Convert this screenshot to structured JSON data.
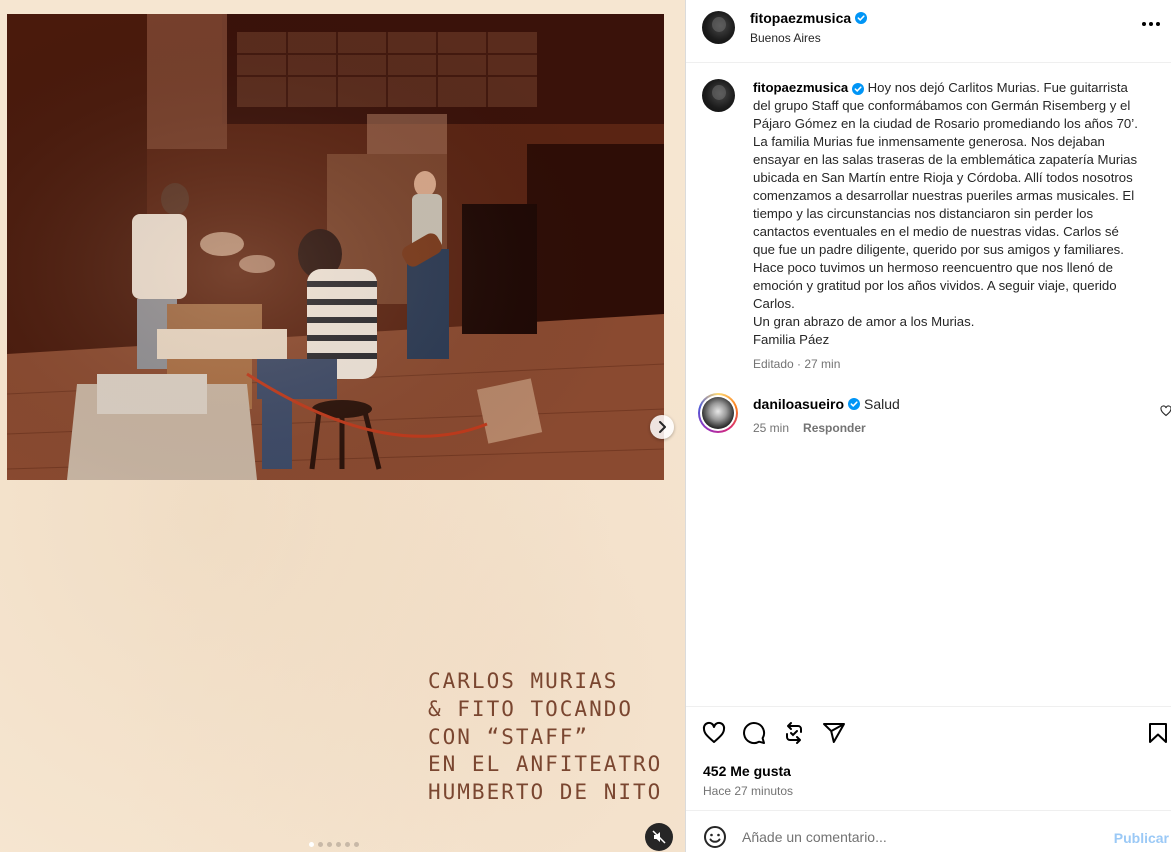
{
  "media": {
    "caption_lines": [
      "CARLOS MURIAS",
      "& FITO TOCANDO",
      "CON “STAFF”",
      "EN EL ANFITEATRO",
      "HUMBERTO DE NITO"
    ],
    "carousel_count": 6,
    "carousel_active": 1
  },
  "header": {
    "username": "fitopaezmusica",
    "location": "Buenos Aires"
  },
  "caption": {
    "username": "fitopaezmusica",
    "lines": [
      "Hoy nos dejó Carlitos Murias. Fue guitarrista",
      "del grupo Staff que conformábamos con Germán Risemberg y el",
      "Pájaro Gómez en la ciudad de Rosario promediando los años 70’.",
      "La familia Murias fue inmensamente generosa. Nos dejaban",
      "ensayar en las salas traseras de la emblemática zapatería Murias",
      "ubicada en San Martín entre Rioja y Córdoba. Allí todos nosotros",
      "comenzamos a desarrollar nuestras pueriles armas musicales. El",
      "tiempo y las circunstancias nos distanciaron sin perder los",
      "cantactos eventuales en el medio de nuestras vidas. Carlos sé",
      "que fue un padre diligente, querido por sus amigos y familiares.",
      "Hace poco tuvimos un hermoso reencuentro que nos llenó de",
      "emoción y gratitud por los años vividos. A seguir viaje, querido",
      "Carlos.",
      "Un gran abrazo de amor a los Murias.",
      "Familia Páez"
    ],
    "meta": "Editado · 27 min"
  },
  "comment": {
    "username": "daniloasueiro",
    "text": "Salud",
    "time": "25 min",
    "reply_label": "Responder"
  },
  "actions": {
    "likes": "452 Me gusta",
    "time": "Hace 27 minutos"
  },
  "add_comment": {
    "placeholder": "Añade un comentario...",
    "publish_label": "Publicar"
  },
  "colors": {
    "verified": "#0095f6",
    "caption_ink": "#7a4630",
    "media_bg": "#f6e6d1",
    "publish_disabled": "#9bc9f6"
  }
}
